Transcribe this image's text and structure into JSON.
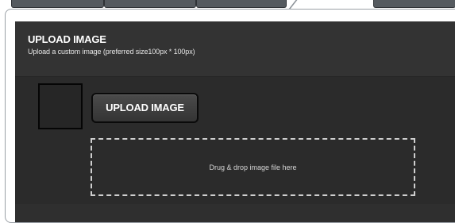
{
  "tabs": [
    {
      "label": ""
    },
    {
      "label": ""
    },
    {
      "label": ""
    },
    {
      "label": ""
    }
  ],
  "upload_section": {
    "title": "UPLOAD IMAGE",
    "subtitle": "Upload a custom image (preferred size100px * 100px)",
    "button_label": "UPLOAD IMAGE",
    "dropzone_text": "Drug & drop image file here"
  },
  "colors": {
    "panel_bg": "#2b2b2b",
    "header_bg": "#333333",
    "text": "#ffffff",
    "dropzone_border": "#cfcfcf"
  }
}
